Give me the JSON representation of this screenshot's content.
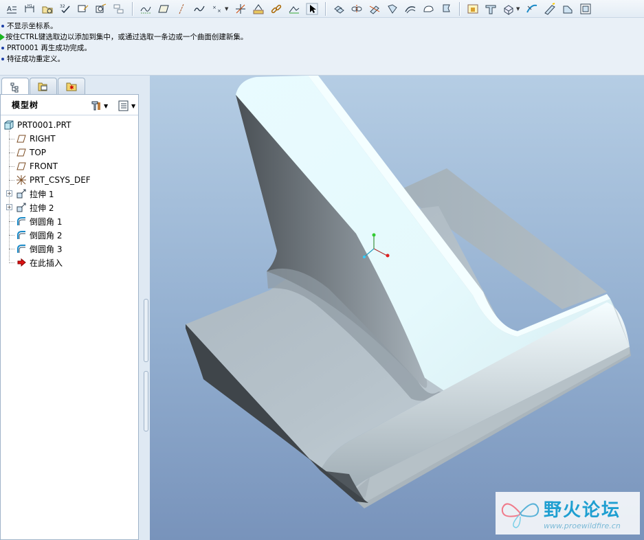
{
  "toolbar": {
    "icons": [
      "text-style-icon",
      "dimension-icon",
      "folder-icon",
      "check-icon",
      "arrow-icon",
      "sketch-icon",
      "repeat-icon",
      "datum-curve-icon",
      "plane-icon",
      "axis-icon",
      "spline-icon",
      "point-icon",
      "csys-icon",
      "analysis-icon",
      "link-icon",
      "view-icon",
      "cursor-icon",
      "copy-icon",
      "mirror-icon",
      "trim-icon",
      "merge-icon",
      "intersect-icon",
      "extend-icon",
      "offset-icon",
      "thicken-icon",
      "solidify-icon",
      "shell-icon",
      "sweep-icon",
      "blend-icon",
      "rib-icon",
      "draft-icon",
      "round-icon"
    ]
  },
  "messages": [
    {
      "type": "info",
      "text": "不显示坐标系。"
    },
    {
      "type": "prompt",
      "text": "按住CTRL键选取边以添加到集中，或通过选取一条边或一个曲面创建新集。"
    },
    {
      "type": "info",
      "text": "PRT0001 再生成功完成。"
    },
    {
      "type": "info",
      "text": "特征成功重定义。"
    }
  ],
  "tree": {
    "title": "模型树",
    "items": [
      {
        "label": "PRT0001.PRT",
        "icon": "part-icon"
      },
      {
        "label": "RIGHT",
        "icon": "datum-plane-icon"
      },
      {
        "label": "TOP",
        "icon": "datum-plane-icon"
      },
      {
        "label": "FRONT",
        "icon": "datum-plane-icon"
      },
      {
        "label": "PRT_CSYS_DEF",
        "icon": "csys-icon"
      },
      {
        "label": "拉伸 1",
        "icon": "extrude-icon"
      },
      {
        "label": "拉伸 2",
        "icon": "extrude-icon"
      },
      {
        "label": "倒圆角 1",
        "icon": "round-icon"
      },
      {
        "label": "倒圆角 2",
        "icon": "round-icon"
      },
      {
        "label": "倒圆角 3",
        "icon": "round-icon"
      },
      {
        "label": "在此插入",
        "icon": "insert-here-icon"
      }
    ]
  },
  "watermark": {
    "title": "野火论坛",
    "subtitle": "www.proewildfire.cn"
  },
  "colors": {
    "viewport_top": "#b5cde4",
    "viewport_bottom": "#7893bb",
    "model_light": "#e8fbfd",
    "model_dark": "#3e4449"
  }
}
